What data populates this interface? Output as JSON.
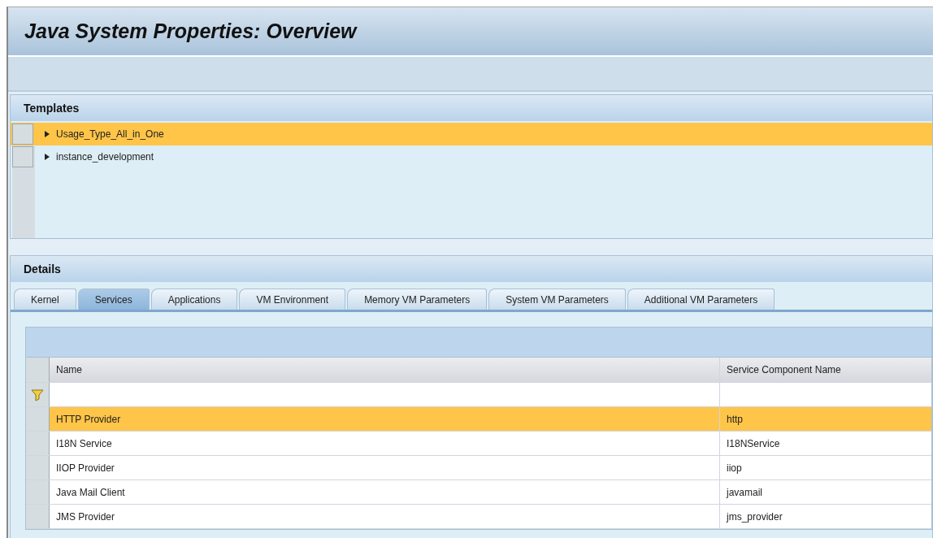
{
  "window": {
    "title": "Java System Properties: Overview"
  },
  "templates": {
    "title": "Templates",
    "items": [
      {
        "label": "Usage_Type_All_in_One",
        "selected": true,
        "expanded": false
      },
      {
        "label": "instance_development",
        "selected": false,
        "expanded": false
      }
    ]
  },
  "details": {
    "title": "Details",
    "tabs": [
      {
        "label": "Kernel",
        "selected": false
      },
      {
        "label": "Services",
        "selected": true
      },
      {
        "label": "Applications",
        "selected": false
      },
      {
        "label": "VM Environment",
        "selected": false
      },
      {
        "label": "Memory VM Parameters",
        "selected": false
      },
      {
        "label": "System VM Parameters",
        "selected": false
      },
      {
        "label": "Additional VM Parameters",
        "selected": false
      }
    ],
    "table": {
      "columns": [
        "Name",
        "Service Component Name"
      ],
      "rows": [
        {
          "cells": [
            "HTTP Provider",
            "http"
          ],
          "selected": true
        },
        {
          "cells": [
            "I18N Service",
            "I18NService"
          ],
          "selected": false
        },
        {
          "cells": [
            "IIOP Provider",
            "iiop"
          ],
          "selected": false
        },
        {
          "cells": [
            "Java Mail Client",
            "javamail"
          ],
          "selected": false
        },
        {
          "cells": [
            "JMS Provider",
            "jms_provider"
          ],
          "selected": false
        }
      ]
    }
  }
}
